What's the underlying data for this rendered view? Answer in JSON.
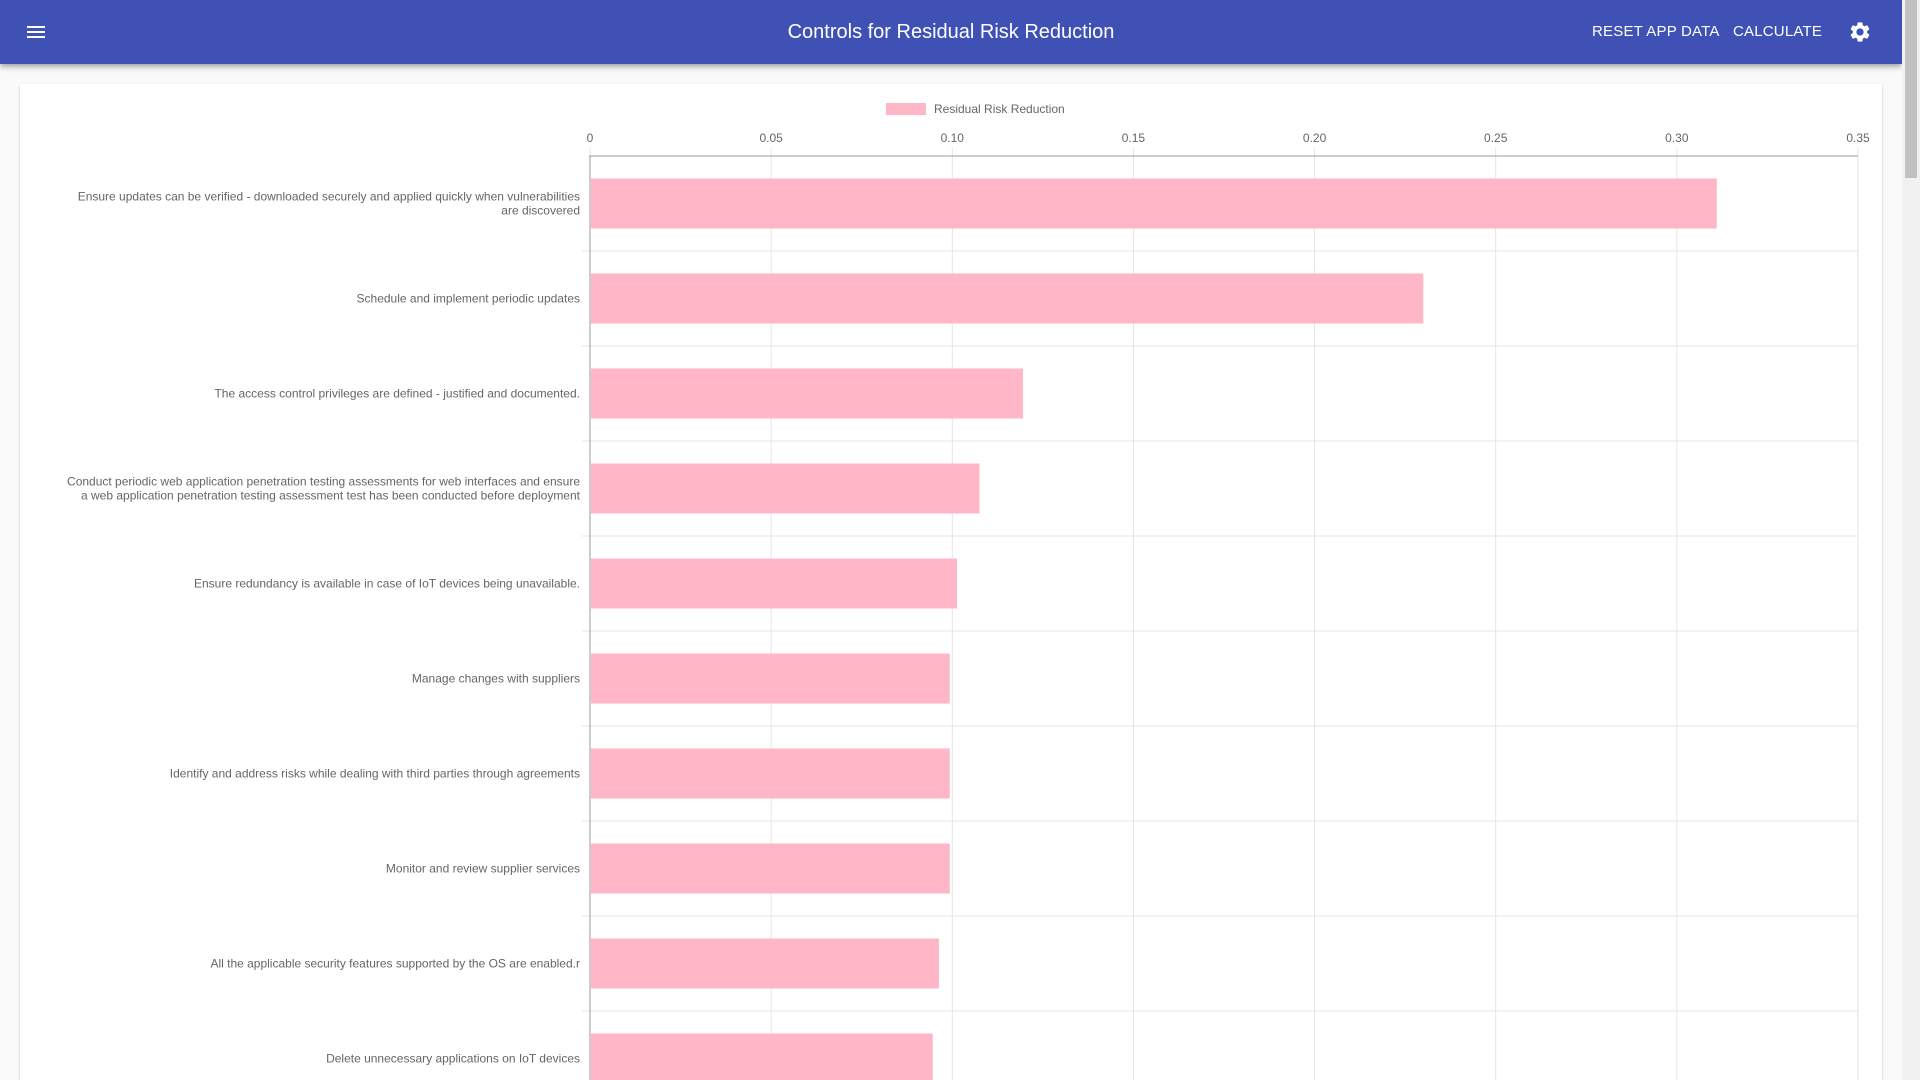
{
  "app": {
    "title": "Controls for Residual Risk Reduction",
    "menu_icon": "menu-icon",
    "settings_icon": "gear-icon",
    "actions": {
      "reset_label": "RESET APP DATA",
      "calculate_label": "CALCULATE"
    },
    "colors": {
      "appbar": "#3f51b5",
      "bar_fill": "#ffb6c7"
    }
  },
  "chart_data": {
    "type": "bar",
    "orientation": "horizontal",
    "legend": "top-center",
    "grid": true,
    "xlim": [
      0,
      0.35
    ],
    "x_ticks": [
      "0",
      "0.05",
      "0.10",
      "0.15",
      "0.20",
      "0.25",
      "0.30",
      "0.35"
    ],
    "series": [
      {
        "name": "Residual Risk Reduction",
        "color": "#ffb6c7",
        "values": [
          0.311,
          0.23,
          0.1195,
          0.1075,
          0.1013,
          0.0993,
          0.0993,
          0.0993,
          0.0963,
          0.0946
        ]
      }
    ],
    "categories": [
      [
        "Ensure updates can be verified -  downloaded securely and applied quickly when vulnerabilities",
        "are discovered"
      ],
      [
        "Schedule and implement periodic updates"
      ],
      [
        "The access control privileges are defined -  justified and documented."
      ],
      [
        "Conduct periodic web application penetration testing assessments for web interfaces and ensure",
        "a web application penetration testing assessment test has been conducted before deployment"
      ],
      [
        "Ensure redundancy is available in case of IoT devices being unavailable."
      ],
      [
        "Manage changes with suppliers"
      ],
      [
        "Identify and address risks while dealing with third parties through agreements"
      ],
      [
        "Monitor and review supplier services"
      ],
      [
        "All the applicable security features supported by the OS are enabled.r"
      ],
      [
        "Delete unnecessary applications on IoT devices"
      ]
    ]
  }
}
